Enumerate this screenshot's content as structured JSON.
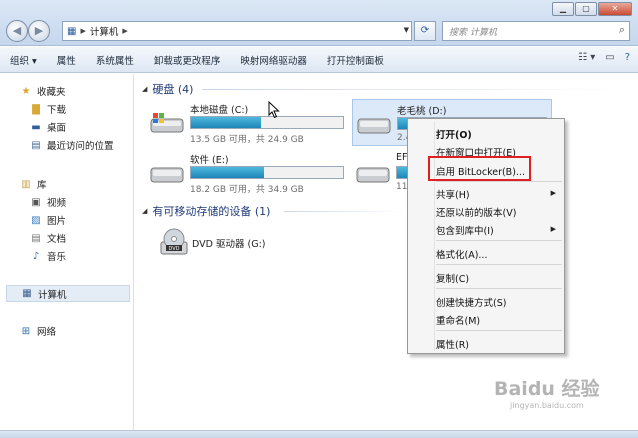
{
  "address_bar": {
    "path": [
      "计算机"
    ],
    "search_placeholder": "搜索 计算机"
  },
  "toolbar": {
    "items": [
      "组织 ▾",
      "属性",
      "系统属性",
      "卸载或更改程序",
      "映射网络驱动器",
      "打开控制面板"
    ]
  },
  "nav": {
    "favorites": "收藏夹",
    "downloads": "下载",
    "desktop": "桌面",
    "recent": "最近访问的位置",
    "libraries": "库",
    "videos": "视频",
    "pictures": "图片",
    "documents": "文档",
    "music": "音乐",
    "computer": "计算机",
    "network": "网络"
  },
  "sections": {
    "hard_disks": "硬盘 (4)",
    "removable": "有可移动存储的设备 (1)"
  },
  "drives": [
    {
      "name": "本地磁盘 (C:)",
      "info": "13.5 GB 可用，共 24.9 GB",
      "used_fraction": 0.46
    },
    {
      "name": "老毛桃 (D:)",
      "info": "2.4",
      "used_fraction": 0.9
    },
    {
      "name": "软件 (E:)",
      "info": "18.2 GB 可用，共 34.9 GB",
      "used_fraction": 0.48
    },
    {
      "name": "EF",
      "info": "11",
      "used_fraction": 0.9
    }
  ],
  "dvd": {
    "name": "DVD 驱动器 (G:)"
  },
  "context_menu": {
    "open": "打开(O)",
    "open_new_window": "在新窗口中打开(E)",
    "bitlocker": "启用 BitLocker(B)...",
    "share": "共享(H)",
    "restore": "还原以前的版本(V)",
    "include_library": "包含到库中(I)",
    "format": "格式化(A)...",
    "copy": "复制(C)",
    "create_shortcut": "创建快捷方式(S)",
    "rename": "重命名(M)",
    "properties": "属性(R)"
  },
  "watermark": {
    "logo": "Baidu 经验",
    "url": "jingyan.baidu.com"
  },
  "colors": {
    "capacity_bar": "#2a94c8",
    "highlight_box": "#e02020",
    "section_heading": "#1e3a78"
  }
}
